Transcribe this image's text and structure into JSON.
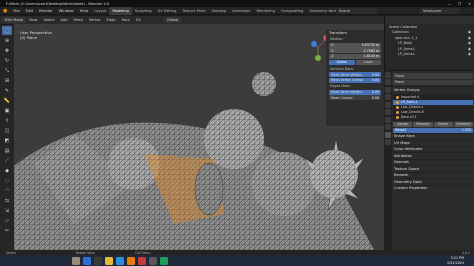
{
  "window": {
    "title": "F:\\Work (C:\\Users\\user\\Desktop\\Werk\\bleed) - Blender 4.0",
    "controls": [
      "—",
      "❐",
      "✕"
    ]
  },
  "menu": {
    "items": [
      "File",
      "Edit",
      "Render",
      "Window",
      "Help"
    ],
    "workspaces": [
      "Layout",
      "Modeling",
      "Sculpting",
      "UV Editing",
      "Texture Paint",
      "Shading",
      "Animation",
      "Rendering",
      "Compositing",
      "Geometry Nodes",
      "Scripting"
    ],
    "active_workspace": "Modeling",
    "scene": "Scene",
    "view_layer": "ViewLayer"
  },
  "viewport_header": {
    "mode": "Edit Mode",
    "items": [
      "View",
      "Select",
      "Add",
      "Mesh",
      "Vertex",
      "Edge",
      "Face",
      "UV"
    ],
    "orientation": "Global"
  },
  "viewport": {
    "view_name": "User Perspective",
    "object_name": "(0) Plane"
  },
  "npanel": {
    "section": "Transform",
    "median_label": "Median:",
    "coords": [
      {
        "k": "X:",
        "v": "0.93705 m"
      },
      {
        "k": "Y:",
        "v": "-2.7963 m"
      },
      {
        "k": "Z:",
        "v": "1.6143 m"
      }
    ],
    "space_tabs": [
      "Global",
      "Local"
    ],
    "active_space": "Global",
    "vertices_data_label": "Vertices Data:",
    "vertices_fields": [
      {
        "k": "Mean Bevel Weight:",
        "v": "0.00"
      },
      {
        "k": "Mean Vertex Crease:",
        "v": "0.00"
      }
    ],
    "edges_data_label": "Edges Data:",
    "edges_fields": [
      {
        "k": "Mean Bevel Weight:",
        "v": "0.00"
      },
      {
        "k": "Mean Crease:",
        "v": "0.00"
      }
    ]
  },
  "outliner": {
    "items": [
      "Scene Collection",
      "Collection",
      "open.scn.1_1",
      "LP_Body",
      "LP_Arms.L",
      "LP_Arms.L"
    ]
  },
  "properties": {
    "object_field": "Plane",
    "data_name": "Plane",
    "vertex_groups_section": "Vertex Groups",
    "vertex_groups": [
      "Imported A",
      "LP_Arms.L",
      "Low_Details.L",
      "Low_Details.R",
      "Base.013"
    ],
    "selected_group_index": 1,
    "buttons": [
      "Assign",
      "Remove",
      "Select",
      "Deselect"
    ],
    "weight_label": "Weight",
    "weight_value": "1.000",
    "sections": [
      "Shape Keys",
      "UV Maps",
      "Color Attributes",
      "Attributes",
      "Normals",
      "Texture Space",
      "Remesh",
      "Geometry Data",
      "Custom Properties"
    ]
  },
  "statusbar": {
    "left": "Select",
    "middle": "Rotate View",
    "right": "Call Menu",
    "version": "4.0.2"
  },
  "taskbar": {
    "time": "5:21 PM",
    "date": "2/24/2024"
  },
  "colors": {
    "accent_blue": "#4772b3",
    "vertex_orange": "#e08a2a",
    "viewport_bg": "#3c3c3c"
  }
}
